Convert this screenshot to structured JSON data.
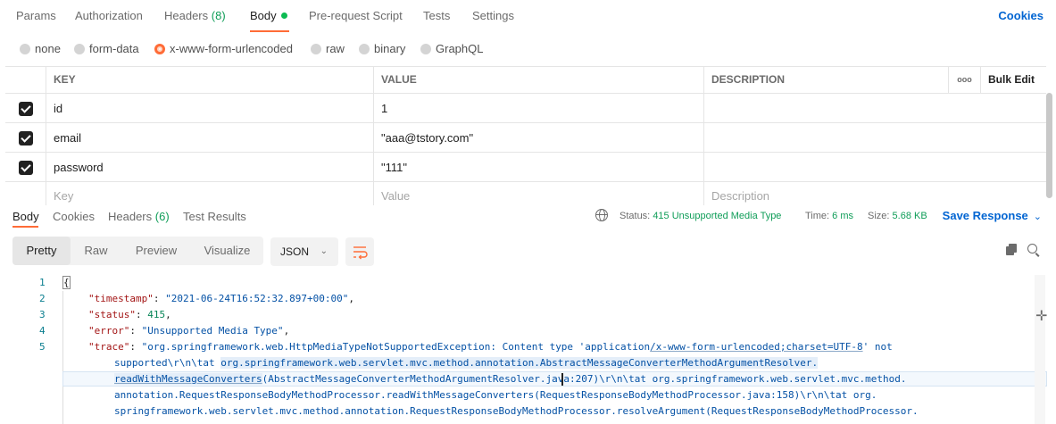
{
  "request_tabs": [
    {
      "label": "Params"
    },
    {
      "label": "Authorization"
    },
    {
      "label": "Headers",
      "count": "(8)"
    },
    {
      "label": "Body"
    },
    {
      "label": "Pre-request Script"
    },
    {
      "label": "Tests"
    },
    {
      "label": "Settings"
    }
  ],
  "cookies_label": "Cookies",
  "body_types": [
    {
      "label": "none",
      "selected": false
    },
    {
      "label": "form-data",
      "selected": false
    },
    {
      "label": "x-www-form-urlencoded",
      "selected": true
    },
    {
      "label": "raw",
      "selected": false
    },
    {
      "label": "binary",
      "selected": false
    },
    {
      "label": "GraphQL",
      "selected": false
    }
  ],
  "kv_table": {
    "headers": {
      "key": "KEY",
      "value": "VALUE",
      "description": "DESCRIPTION",
      "more": "ooo",
      "bulk_edit": "Bulk Edit"
    },
    "rows": [
      {
        "checked": true,
        "key": "id",
        "value": "1",
        "description": ""
      },
      {
        "checked": true,
        "key": "email",
        "value": "\"aaa@tstory.com\"",
        "description": ""
      },
      {
        "checked": true,
        "key": "password",
        "value": "\"111\"",
        "description": ""
      }
    ],
    "placeholders": {
      "key": "Key",
      "value": "Value",
      "description": "Description"
    }
  },
  "response_tabs": [
    {
      "label": "Body"
    },
    {
      "label": "Cookies"
    },
    {
      "label": "Headers",
      "count": "(6)"
    },
    {
      "label": "Test Results"
    }
  ],
  "response_meta": {
    "status_label": "Status:",
    "status_value": "415 Unsupported Media Type",
    "time_label": "Time:",
    "time_value": "6 ms",
    "size_label": "Size:",
    "size_value": "5.68 KB",
    "save_label": "Save Response"
  },
  "view_modes": [
    "Pretty",
    "Raw",
    "Preview",
    "Visualize"
  ],
  "format_label": "JSON",
  "line_numbers": [
    "1",
    "2",
    "3",
    "4",
    "5"
  ],
  "code": {
    "l1": "{",
    "timestamp_key": "\"timestamp\"",
    "timestamp_val": "\"2021-06-24T16:52:32.897+00:00\"",
    "status_key": "\"status\"",
    "status_val": "415",
    "error_key": "\"error\"",
    "error_val": "\"Unsupported Media Type\"",
    "trace_key": "\"trace\"",
    "trace_1a": "\"org.springframework.web.HttpMediaTypeNotSupportedException: Content type 'application",
    "trace_1b": "/x-www-form-urlencoded;charset=UTF-8",
    "trace_1c": "' not",
    "trace_2a": "supported\\r\\n\\tat ",
    "trace_2b": "org.springframework.web.servlet.mvc.method.annotation.AbstractMessageConverterMethodArgumentResolver.",
    "trace_3a": "readWithMessageConverters",
    "trace_3b": "(AbstractMessageConverterMethodArgumentResolver.java:207)\\r\\n\\tat org.springframework.web.servlet.mvc.method.",
    "trace_4": "annotation.RequestResponseBodyMethodProcessor.readWithMessageConverters(RequestResponseBodyMethodProcessor.java:158)\\r\\n\\tat org.",
    "trace_5": "springframework.web.servlet.mvc.method.annotation.RequestResponseBodyMethodProcessor.resolveArgument(RequestResponseBodyMethodProcessor."
  },
  "colors": {
    "accent": "#ff6c37",
    "link": "#0265d2",
    "success": "#0f9d58"
  }
}
